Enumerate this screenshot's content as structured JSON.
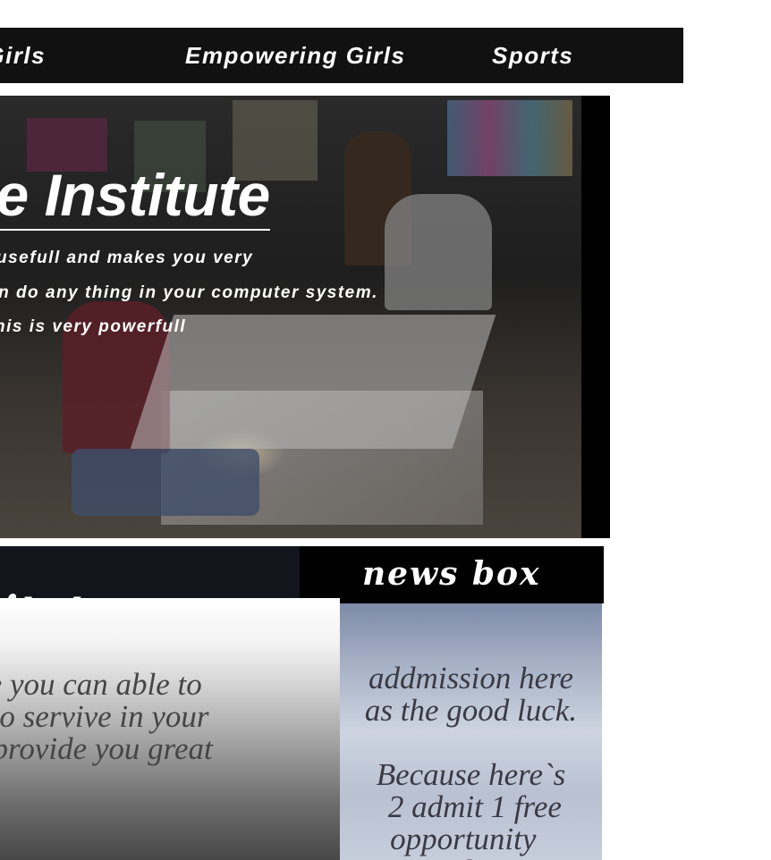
{
  "nav": {
    "items": [
      {
        "label": "ting Girls"
      },
      {
        "label": "Empowering Girls"
      },
      {
        "label": "Sports"
      }
    ]
  },
  "hero": {
    "title": "tive Institute",
    "lines": [
      " usefull and makes you very",
      "an do any thing in your computer system.",
      "his is very powerfull"
    ],
    "colors": {
      "overlay": "#000000",
      "text": "#ffffff"
    }
  },
  "section": {
    "heading": "nstitute"
  },
  "about": {
    "text": "itute you can able to\now to servive in your\nute provide you great"
  },
  "newsbox": {
    "title": "news box",
    "text": "addmission here\nas the good luck.\n\nBecause here`s\n 2 admit 1 free\nopportunity  \n students."
  }
}
